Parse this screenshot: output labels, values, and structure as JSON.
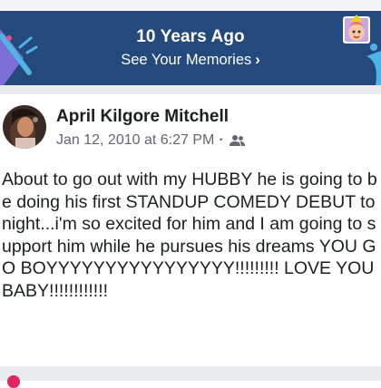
{
  "memories_banner": {
    "title": "10 Years Ago",
    "link_label": "See Your Memories",
    "link_chevron": "›",
    "colors": {
      "background": "#24497d",
      "text": "#ffffff"
    }
  },
  "post": {
    "author": "April Kilgore Mitchell",
    "timestamp": "Jan 12, 2010 at 6:27 PM",
    "separator": "·",
    "audience_icon": "friends-icon",
    "text": "About to go out with my HUBBY he is going to be doing his first STANDUP COMEDY DEBUT tonight...i'm so excited for him and I am going to support him while he pursues his dreams YOU GO BOYYYYYYYYYYYYYYYY!!!!!!!!! LOVE YOU BABY!!!!!!!!!!!!"
  }
}
